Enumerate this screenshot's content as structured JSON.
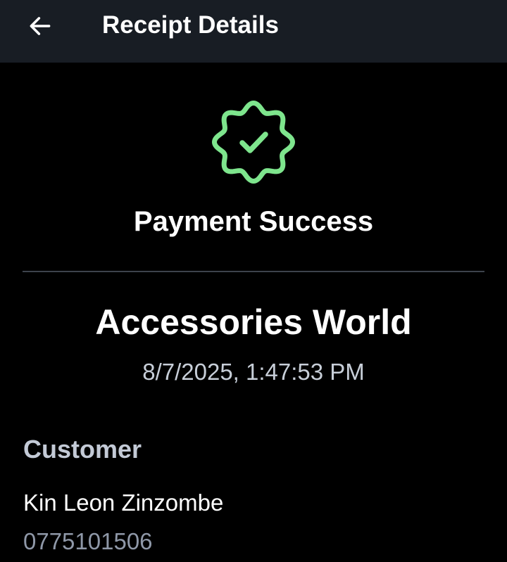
{
  "app_bar": {
    "title": "Receipt Details",
    "back_icon": "arrow-left-icon"
  },
  "status": {
    "icon": "verified-badge-icon",
    "icon_color": "#7ee58d",
    "text": "Payment Success"
  },
  "merchant": {
    "name": "Accessories World",
    "timestamp": "8/7/2025, 1:47:53 PM"
  },
  "customer": {
    "label": "Customer",
    "name": "Kin Leon Zinzombe",
    "phone": "0775101506"
  },
  "colors": {
    "app_bar_bg": "#181d24",
    "background": "#000000",
    "accent_green": "#7ee58d",
    "muted_text": "#8f98a8"
  }
}
